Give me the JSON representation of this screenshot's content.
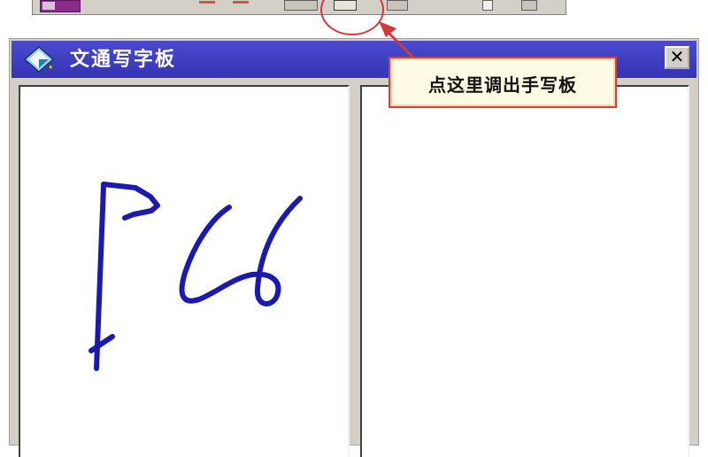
{
  "window": {
    "title": "文通写字板",
    "close_label": "✕"
  },
  "callout": {
    "text": "点这里调出手写板"
  },
  "colors": {
    "titlebar": "#3a3ac0",
    "ink": "#1a1ab0",
    "annotation_red": "#d43a3a",
    "callout_bg": "#fffbe4"
  },
  "icons": [
    "app-icon",
    "close-icon",
    "handwriting-pad-button-icon"
  ]
}
